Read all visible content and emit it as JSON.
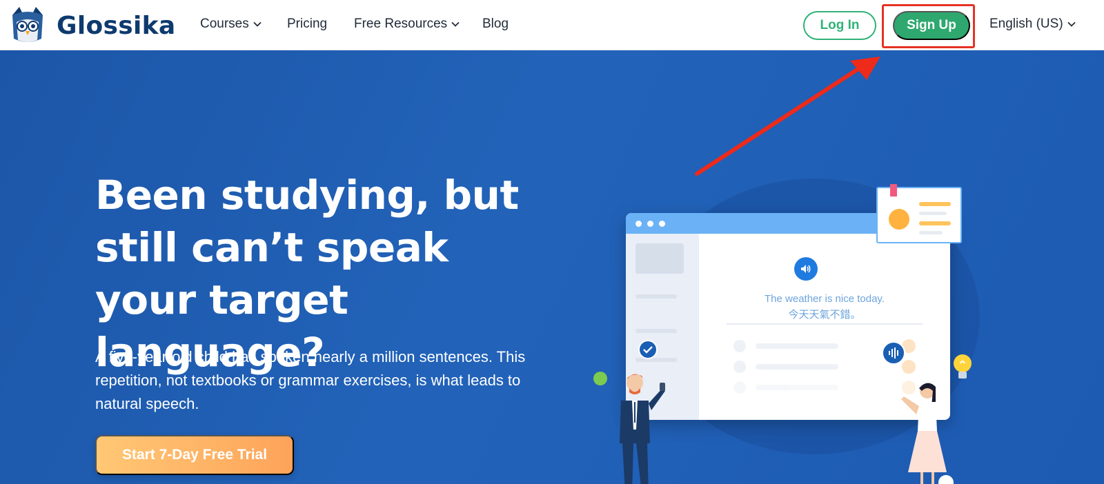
{
  "brand": {
    "name": "Glossika"
  },
  "nav": {
    "items": [
      {
        "label": "Courses",
        "has_dropdown": true
      },
      {
        "label": "Pricing",
        "has_dropdown": false
      },
      {
        "label": "Free Resources",
        "has_dropdown": true
      },
      {
        "label": "Blog",
        "has_dropdown": false
      }
    ],
    "login_label": "Log In",
    "signup_label": "Sign Up",
    "language": "English (US)"
  },
  "hero": {
    "headline": "Been studying, but still can’t speak your target language?",
    "subtext": "A five-year-old child has spoken nearly a million sentences. This repetition, not textbooks or grammar exercises, is what leads to natural speech.",
    "cta_label": "Start 7-Day Free Trial"
  },
  "illustration": {
    "sample_en": "The weather is nice today.",
    "sample_zh": "今天天氣不錯。"
  },
  "colors": {
    "brand_navy": "#0e3a6e",
    "accent_green": "#2ea86f",
    "hero_blue": "#1f5fb5",
    "cta_orange": "#fda35a",
    "annotation_red": "#e53224"
  }
}
